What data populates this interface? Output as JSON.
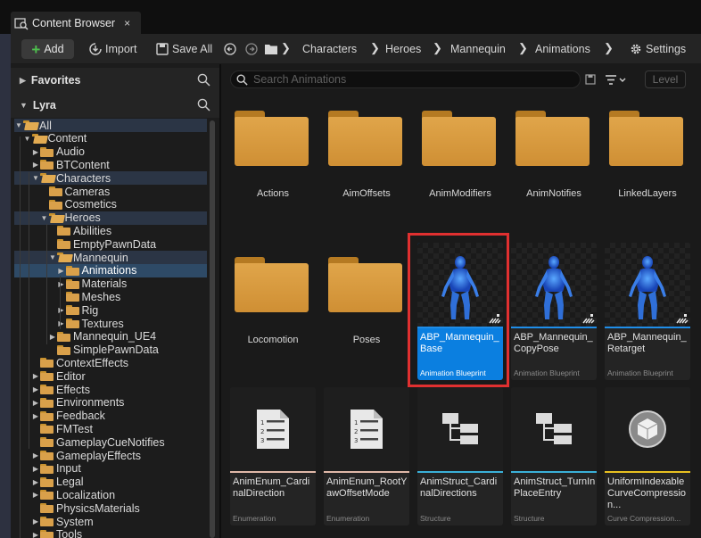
{
  "tab": {
    "title": "Content Browser",
    "close": "×"
  },
  "toolbar": {
    "add_label": "Add",
    "import_label": "Import",
    "save_all_label": "Save All",
    "settings_label": "Settings",
    "breadcrumb": [
      "Characters",
      "Heroes",
      "Mannequin",
      "Animations"
    ]
  },
  "sidebar": {
    "favorites_label": "Favorites",
    "project_label": "Lyra",
    "tree": [
      {
        "label": "All",
        "depth": 0,
        "open": true,
        "arrow": true,
        "state": "hl"
      },
      {
        "label": "Content",
        "depth": 1,
        "open": true,
        "arrow": true,
        "state": ""
      },
      {
        "label": "Audio",
        "depth": 2,
        "open": false,
        "arrow": true,
        "state": ""
      },
      {
        "label": "BTContent",
        "depth": 2,
        "open": false,
        "arrow": true,
        "state": ""
      },
      {
        "label": "Characters",
        "depth": 2,
        "open": true,
        "arrow": true,
        "state": "hl"
      },
      {
        "label": "Cameras",
        "depth": 3,
        "open": false,
        "arrow": false,
        "state": ""
      },
      {
        "label": "Cosmetics",
        "depth": 3,
        "open": false,
        "arrow": false,
        "state": ""
      },
      {
        "label": "Heroes",
        "depth": 3,
        "open": true,
        "arrow": true,
        "state": "hl"
      },
      {
        "label": "Abilities",
        "depth": 4,
        "open": false,
        "arrow": false,
        "state": ""
      },
      {
        "label": "EmptyPawnData",
        "depth": 4,
        "open": false,
        "arrow": false,
        "state": ""
      },
      {
        "label": "Mannequin",
        "depth": 4,
        "open": true,
        "arrow": true,
        "state": "hl"
      },
      {
        "label": "Animations",
        "depth": 5,
        "open": false,
        "arrow": true,
        "state": "sel"
      },
      {
        "label": "Materials",
        "depth": 5,
        "open": false,
        "arrow": true,
        "state": ""
      },
      {
        "label": "Meshes",
        "depth": 5,
        "open": false,
        "arrow": false,
        "state": ""
      },
      {
        "label": "Rig",
        "depth": 5,
        "open": false,
        "arrow": true,
        "state": ""
      },
      {
        "label": "Textures",
        "depth": 5,
        "open": false,
        "arrow": true,
        "state": ""
      },
      {
        "label": "Mannequin_UE4",
        "depth": 4,
        "open": false,
        "arrow": true,
        "state": ""
      },
      {
        "label": "SimplePawnData",
        "depth": 4,
        "open": false,
        "arrow": false,
        "state": ""
      },
      {
        "label": "ContextEffects",
        "depth": 2,
        "open": false,
        "arrow": false,
        "state": ""
      },
      {
        "label": "Editor",
        "depth": 2,
        "open": false,
        "arrow": true,
        "state": ""
      },
      {
        "label": "Effects",
        "depth": 2,
        "open": false,
        "arrow": true,
        "state": ""
      },
      {
        "label": "Environments",
        "depth": 2,
        "open": false,
        "arrow": true,
        "state": ""
      },
      {
        "label": "Feedback",
        "depth": 2,
        "open": false,
        "arrow": true,
        "state": ""
      },
      {
        "label": "FMTest",
        "depth": 2,
        "open": false,
        "arrow": false,
        "state": ""
      },
      {
        "label": "GameplayCueNotifies",
        "depth": 2,
        "open": false,
        "arrow": false,
        "state": ""
      },
      {
        "label": "GameplayEffects",
        "depth": 2,
        "open": false,
        "arrow": true,
        "state": ""
      },
      {
        "label": "Input",
        "depth": 2,
        "open": false,
        "arrow": true,
        "state": ""
      },
      {
        "label": "Legal",
        "depth": 2,
        "open": false,
        "arrow": true,
        "state": ""
      },
      {
        "label": "Localization",
        "depth": 2,
        "open": false,
        "arrow": true,
        "state": ""
      },
      {
        "label": "PhysicsMaterials",
        "depth": 2,
        "open": false,
        "arrow": false,
        "state": ""
      },
      {
        "label": "System",
        "depth": 2,
        "open": false,
        "arrow": true,
        "state": ""
      },
      {
        "label": "Tools",
        "depth": 2,
        "open": false,
        "arrow": true,
        "state": ""
      }
    ]
  },
  "main": {
    "search_placeholder": "Search Animations",
    "level_label": "Level",
    "folders": [
      "Actions",
      "AimOffsets",
      "AnimModifiers",
      "AnimNotifies",
      "LinkedLayers",
      "Locomotion",
      "Poses"
    ],
    "assets": [
      {
        "name": "ABP_Mannequin_Base",
        "type": "Animation Blueprint",
        "selected": true,
        "kind": "mannequin",
        "bar_color": "#1f8de8"
      },
      {
        "name": "ABP_Mannequin_CopyPose",
        "type": "Animation Blueprint",
        "selected": false,
        "kind": "mannequin",
        "bar_color": "#1f8de8"
      },
      {
        "name": "ABP_Mannequin_Retarget",
        "type": "Animation Blueprint",
        "selected": false,
        "kind": "mannequin",
        "bar_color": "#1f8de8"
      },
      {
        "name": "AnimEnum_CardinalDirection",
        "type": "Enumeration",
        "selected": false,
        "kind": "document",
        "bar_color": "#e0b8a8"
      },
      {
        "name": "AnimEnum_RootYawOffsetMode",
        "type": "Enumeration",
        "selected": false,
        "kind": "document",
        "bar_color": "#e0b8a8"
      },
      {
        "name": "AnimStruct_CardinalDirections",
        "type": "Structure",
        "selected": false,
        "kind": "struct",
        "bar_color": "#3ab0d8"
      },
      {
        "name": "AnimStruct_TurnInPlaceEntry",
        "type": "Structure",
        "selected": false,
        "kind": "struct",
        "bar_color": "#3ab0d8"
      },
      {
        "name": "UniformIndexableCurveCompression...",
        "type": "Curve Compression...",
        "selected": false,
        "kind": "cube",
        "bar_color": "#e8c020"
      }
    ]
  }
}
